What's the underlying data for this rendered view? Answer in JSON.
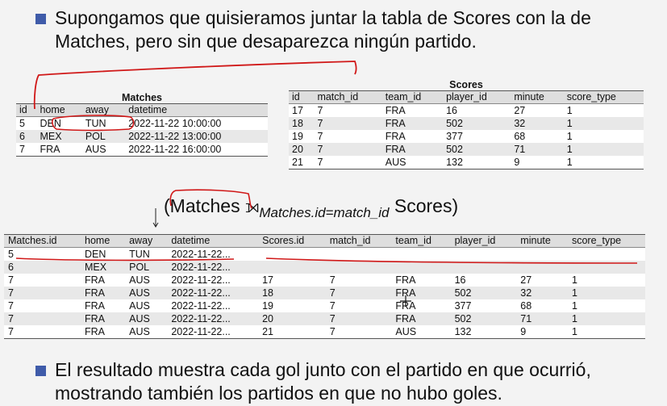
{
  "bullets": [
    {
      "lines": [
        "Supongamos que quisieramos juntar la tabla de Scores con la de",
        "Matches, pero sin que desaparezca ningún partido."
      ]
    },
    {
      "lines": [
        "El resultado muestra cada gol junto con el partido en que ocurrió,",
        "mostrando también los partidos en que no hubo goles."
      ]
    }
  ],
  "matches": {
    "title": "Matches",
    "columns": [
      "id",
      "home",
      "away",
      "datetime"
    ],
    "rows": [
      [
        "5",
        "DEN",
        "TUN",
        "2022-11-22 10:00:00"
      ],
      [
        "6",
        "MEX",
        "POL",
        "2022-11-22 13:00:00"
      ],
      [
        "7",
        "FRA",
        "AUS",
        "2022-11-22 16:00:00"
      ]
    ]
  },
  "scores": {
    "title": "Scores",
    "columns": [
      "id",
      "match_id",
      "team_id",
      "player_id",
      "minute",
      "score_type"
    ],
    "rows": [
      [
        "17",
        "7",
        "FRA",
        "16",
        "27",
        "1"
      ],
      [
        "18",
        "7",
        "FRA",
        "502",
        "32",
        "1"
      ],
      [
        "19",
        "7",
        "FRA",
        "377",
        "68",
        "1"
      ],
      [
        "20",
        "7",
        "FRA",
        "502",
        "71",
        "1"
      ],
      [
        "21",
        "7",
        "AUS",
        "132",
        "9",
        "1"
      ]
    ]
  },
  "formula": {
    "left": "(Matches ",
    "op": "⟕",
    "condition": "Matches.id=match_id",
    "right": " Scores)"
  },
  "result": {
    "columns": [
      "Matches.id",
      "home",
      "away",
      "datetime",
      "Scores.id",
      "match_id",
      "team_id",
      "player_id",
      "minute",
      "score_type"
    ],
    "rows": [
      [
        "5",
        "DEN",
        "TUN",
        "2022-11-22...",
        "",
        "",
        "",
        "",
        "",
        ""
      ],
      [
        "6",
        "MEX",
        "POL",
        "2022-11-22...",
        "",
        "",
        "",
        "",
        "",
        ""
      ],
      [
        "7",
        "FRA",
        "AUS",
        "2022-11-22...",
        "17",
        "7",
        "FRA",
        "16",
        "27",
        "1"
      ],
      [
        "7",
        "FRA",
        "AUS",
        "2022-11-22...",
        "18",
        "7",
        "FRA",
        "502",
        "32",
        "1"
      ],
      [
        "7",
        "FRA",
        "AUS",
        "2022-11-22...",
        "19",
        "7",
        "FRA",
        "377",
        "68",
        "1"
      ],
      [
        "7",
        "FRA",
        "AUS",
        "2022-11-22...",
        "20",
        "7",
        "FRA",
        "502",
        "71",
        "1"
      ],
      [
        "7",
        "FRA",
        "AUS",
        "2022-11-22...",
        "21",
        "7",
        "AUS",
        "132",
        "9",
        "1"
      ]
    ]
  },
  "colors": {
    "bullet": "#3f5ba9",
    "annotation": "#d01818",
    "background": "#f3f3f3"
  }
}
